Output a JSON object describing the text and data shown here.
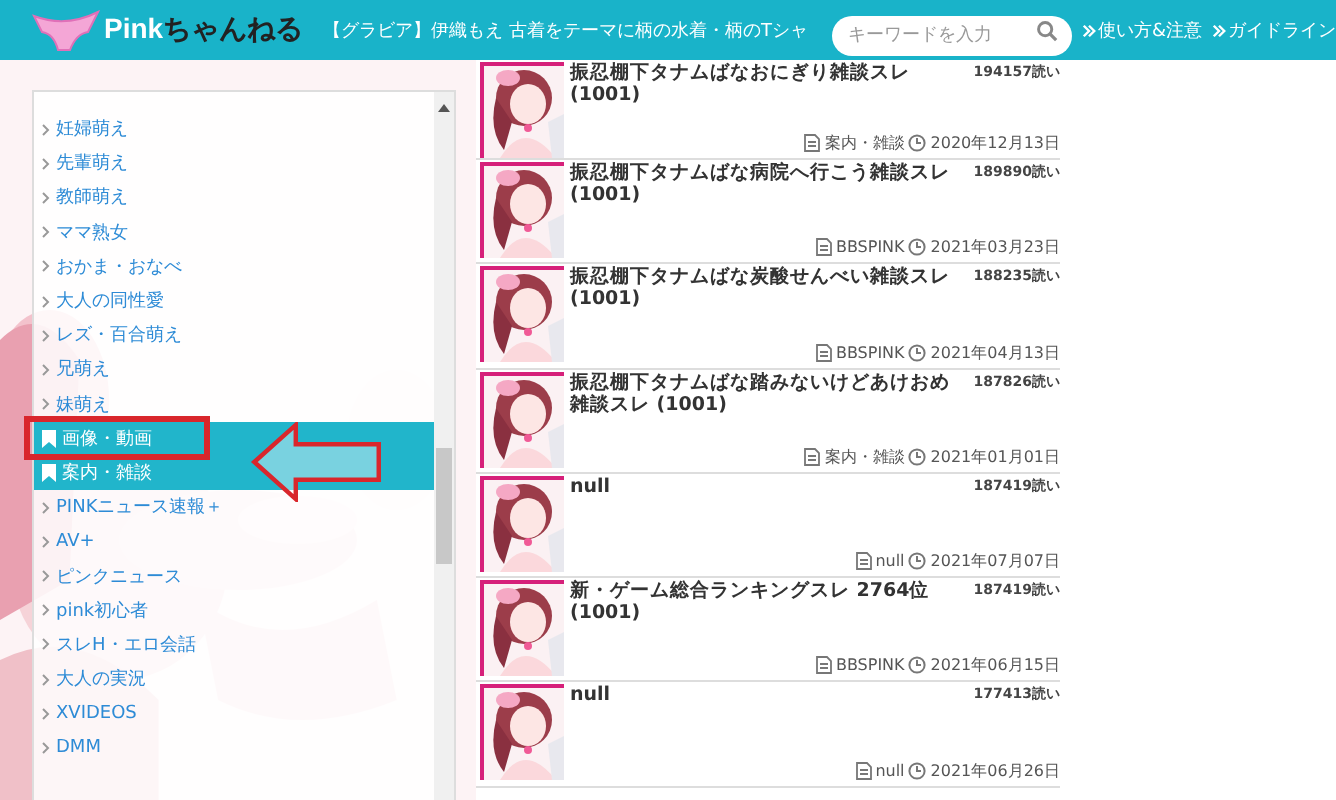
{
  "header": {
    "site_name_accent": "Pink",
    "site_name": "ちゃんねる",
    "ticker": "【グラビア】伊織もえ 古着をテーマに柄の水着・柄のTシャ",
    "search": {
      "placeholder": "キーワードを入力"
    },
    "links": [
      "使い方&注意",
      "ガイドライン"
    ]
  },
  "sidebar": {
    "items": [
      {
        "kind": "link",
        "label": "妊婦萌え"
      },
      {
        "kind": "link",
        "label": "先輩萌え"
      },
      {
        "kind": "link",
        "label": "教師萌え"
      },
      {
        "kind": "link",
        "label": "ママ熟女"
      },
      {
        "kind": "link",
        "label": "おかま・おなべ"
      },
      {
        "kind": "link",
        "label": "大人の同性愛"
      },
      {
        "kind": "link",
        "label": "レズ・百合萌え"
      },
      {
        "kind": "link",
        "label": "兄萌え"
      },
      {
        "kind": "link",
        "label": "妹萌え"
      },
      {
        "kind": "category",
        "label": "画像・動画"
      },
      {
        "kind": "category",
        "label": "案内・雑談"
      },
      {
        "kind": "link",
        "label": "PINKニュース速報＋"
      },
      {
        "kind": "link",
        "label": "AV+"
      },
      {
        "kind": "link",
        "label": "ピンクニュース"
      },
      {
        "kind": "link",
        "label": "pink初心者"
      },
      {
        "kind": "link",
        "label": "スレH・エロ会話"
      },
      {
        "kind": "link",
        "label": "大人の実況"
      },
      {
        "kind": "link",
        "label": "XVIDEOS"
      },
      {
        "kind": "link",
        "label": "DMM"
      }
    ]
  },
  "threads": [
    {
      "title": "振忍棚下タナムばなおにぎり雑談スレ (1001)",
      "views": "194157読い",
      "board": "案内・雑談",
      "date": "2020年12月13日"
    },
    {
      "title": "振忍棚下タナムばな病院へ行こう雑談スレ (1001)",
      "views": "189890読い",
      "board": "BBSPINK",
      "date": "2021年03月23日"
    },
    {
      "title": "振忍棚下タナムばな炭酸せんべい雑談スレ (1001)",
      "views": "188235読い",
      "board": "BBSPINK",
      "date": "2021年04月13日"
    },
    {
      "title": "振忍棚下タナムばな踏みないけどあけおめ雑談スレ (1001)",
      "views": "187826読い",
      "board": "案内・雑談",
      "date": "2021年01月01日"
    },
    {
      "title": "null",
      "views": "187419読い",
      "board": "null",
      "date": "2021年07月07日"
    },
    {
      "title": "新・ゲーム総合ランキングスレ 2764位 (1001)",
      "views": "187419読い",
      "board": "BBSPINK",
      "date": "2021年06月15日"
    },
    {
      "title": "null",
      "views": "177413読い",
      "board": "null",
      "date": "2021年06月26日"
    }
  ]
}
